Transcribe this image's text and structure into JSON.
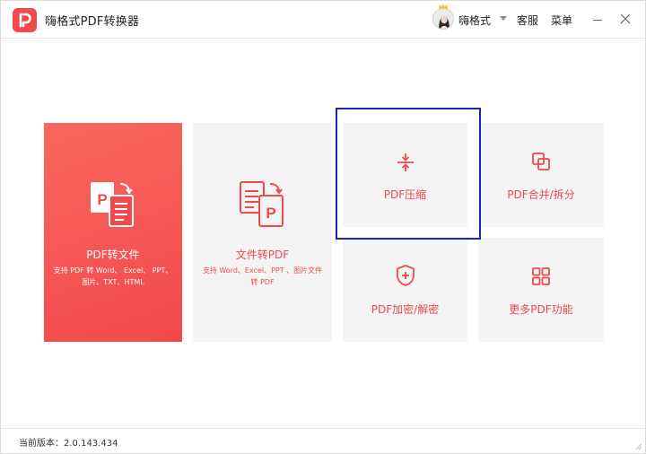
{
  "app": {
    "title": "嗨格式PDF转换器",
    "brand_color": "#f0494e"
  },
  "header": {
    "username": "嗨格式",
    "service_label": "客服",
    "menu_label": "菜单"
  },
  "cards": {
    "pdf_to_file": {
      "label": "PDF转文件",
      "desc": "支持 PDF 转 Word、 Excel、 PPT、图片、TXT、HTML"
    },
    "file_to_pdf": {
      "label": "文件转PDF",
      "desc": "支持 Word、Excel、PPT 、图片文件转 PDF"
    },
    "compress": {
      "label": "PDF压缩"
    },
    "merge_split": {
      "label": "PDF合并/拆分"
    },
    "encrypt": {
      "label": "PDF加密/解密"
    },
    "more": {
      "label": "更多PDF功能"
    }
  },
  "icons": {
    "logo": "pdf-logo-icon",
    "avatar": "user-avatar",
    "crown": "crown-icon",
    "dropdown": "chevron-down-icon",
    "minimize": "minimize-icon",
    "close": "close-icon",
    "pdf_to_file": "pdf-to-file-icon",
    "file_to_pdf": "file-to-pdf-icon",
    "compress": "compress-icon",
    "merge": "merge-icon",
    "shield": "shield-plus-icon",
    "grid": "grid-icon"
  },
  "status": {
    "version_text": "当前版本：2.0.143.434"
  }
}
